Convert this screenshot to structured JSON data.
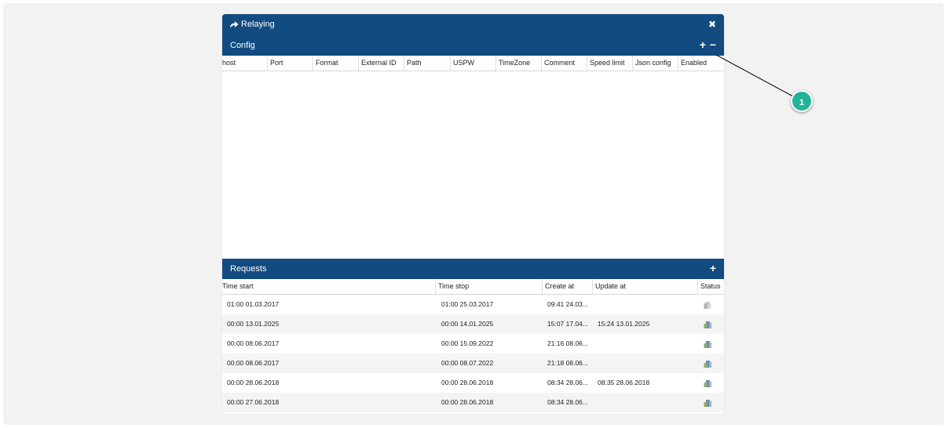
{
  "window": {
    "title": "Relaying",
    "close_icon": "close-icon",
    "title_icon": "share-arrow-icon"
  },
  "config": {
    "label": "Config",
    "add_label": "+",
    "remove_label": "−",
    "columns": [
      "host",
      "Port",
      "Format",
      "External ID",
      "Path",
      "USPW",
      "TimeZone",
      "Comment",
      "Speed limit",
      "Json config",
      "Enabled"
    ]
  },
  "requests": {
    "label": "Requests",
    "add_label": "+",
    "columns": [
      "Time start",
      "Time stop",
      "Create at",
      "Update at",
      "Status"
    ],
    "rows": [
      {
        "start": "01:00 01.03.2017",
        "stop": "01:00 25.03.2017",
        "create": "09:41 24.03...",
        "update": "",
        "status": "pending"
      },
      {
        "start": "00:00 13.01.2025",
        "stop": "00:00 14.01.2025",
        "create": "15:07 17.04...",
        "update": "15:24 13.01.2025",
        "status": "done"
      },
      {
        "start": "00:00 08.06.2017",
        "stop": "00:00 15.09.2022",
        "create": "21:16 08.06...",
        "update": "",
        "status": "done"
      },
      {
        "start": "00:00 08.06.2017",
        "stop": "00:00 08.07.2022",
        "create": "21:18 08.06...",
        "update": "",
        "status": "done"
      },
      {
        "start": "00:00 28.06.2018",
        "stop": "00:00 28.06.2018",
        "create": "08:34 28.06...",
        "update": "08:35 28.06.2018",
        "status": "done"
      },
      {
        "start": "00:00 27.06.2018",
        "stop": "00:00 28.06.2018",
        "create": "08:34 28.06...",
        "update": "",
        "status": "done"
      }
    ]
  },
  "callout": {
    "number": "1"
  },
  "colors": {
    "header_blue": "#114b80",
    "callout_green": "#22b39a",
    "backdrop": "#f2f2f2"
  }
}
